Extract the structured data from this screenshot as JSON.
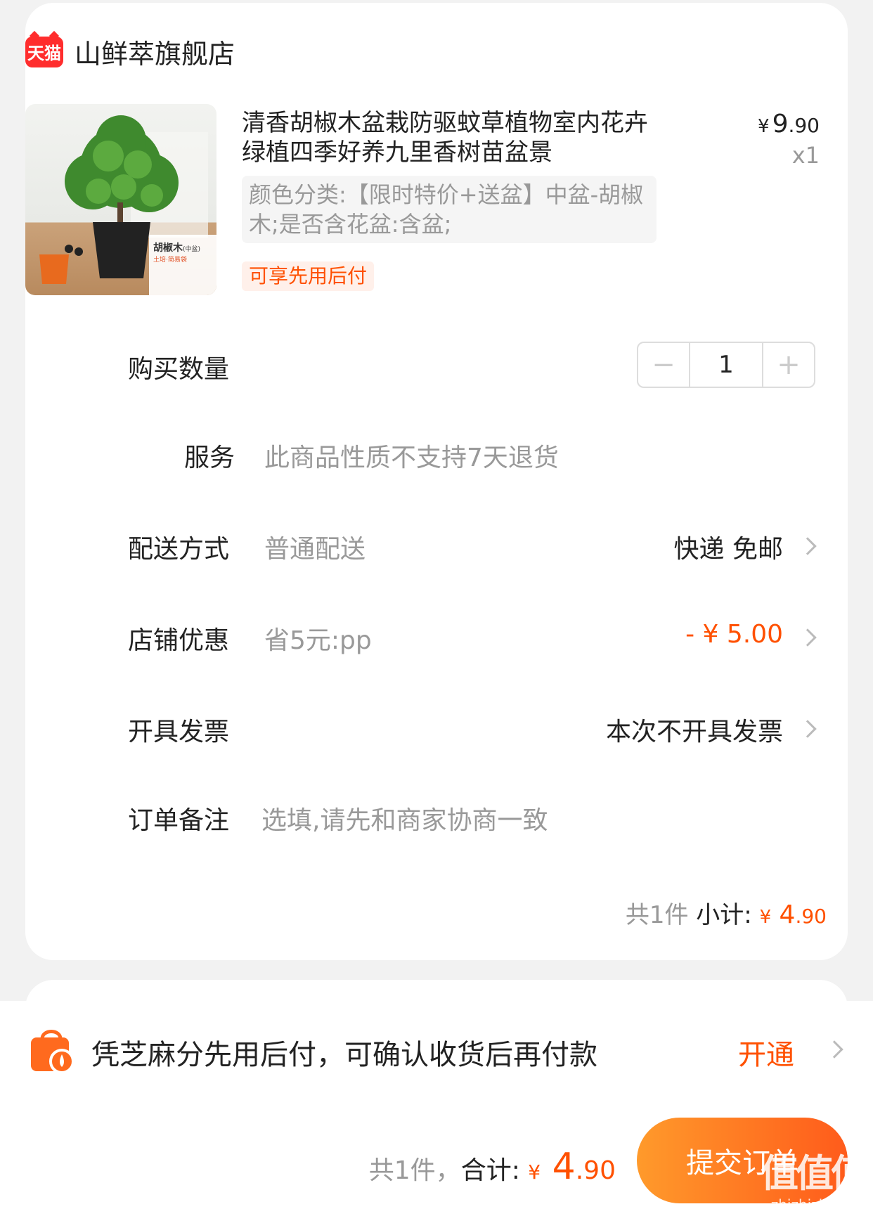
{
  "shop": {
    "badge": "天猫",
    "name": "山鲜萃旗舰店"
  },
  "product": {
    "image_label": "胡椒木",
    "image_label_small": "(中盆)",
    "image_sub": "土培·简易袋",
    "title": "清香胡椒木盆栽防驱蚊草植物室内花卉绿植四季好养九里香树苗盆景",
    "price_currency": "¥",
    "price_int": "9",
    "price_dec": ".90",
    "qty": "x1",
    "sku": "颜色分类:【限时特价+送盆】中盆-胡椒木;是否含花盆:含盆;",
    "pay_later_badge": "可享先用后付"
  },
  "quantity": {
    "label": "购买数量",
    "minus": "−",
    "value": "1",
    "plus": "+"
  },
  "service": {
    "label": "服务",
    "value": "此商品性质不支持7天退货"
  },
  "delivery": {
    "label": "配送方式",
    "value": "普通配送",
    "right": "快递 免邮"
  },
  "discount": {
    "label": "店铺优惠",
    "value": "省5元:pp",
    "right": "- ¥ 5.00"
  },
  "invoice": {
    "label": "开具发票",
    "right": "本次不开具发票"
  },
  "note": {
    "label": "订单备注",
    "placeholder": "选填,请先和商家协商一致"
  },
  "subtotal": {
    "count": "共1件",
    "label": "小计:",
    "currency": "¥",
    "int": " 4",
    "dec": ".90"
  },
  "pay_later": {
    "text": "凭芝麻分先用后付，可确认收货后再付款",
    "action": "开通"
  },
  "footer": {
    "count": "共1件，",
    "total_label": "合计:",
    "currency": "¥",
    "total_int": " 4",
    "total_dec": ".90",
    "submit": "提交订单"
  },
  "watermark": {
    "text": "值值值",
    "url": "zhizhizhi.com"
  },
  "colors": {
    "accent": "#ff5000",
    "tmall": "#ff2d2d",
    "submit_from": "#ff9a2b",
    "submit_to": "#ff5b1b"
  }
}
